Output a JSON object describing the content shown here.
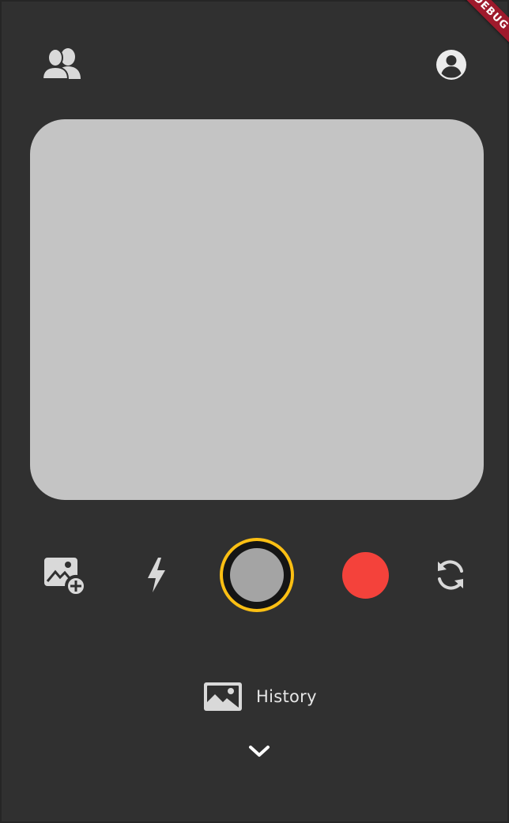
{
  "app": {
    "debug_banner": "DEBUG"
  },
  "header": {
    "friends_icon": "people-icon",
    "profile_icon": "account-circle-icon"
  },
  "controls": {
    "gallery_icon": "add-photo-icon",
    "flash_icon": "flash-icon",
    "shutter_colors": {
      "outer": "#fbbf13",
      "ring": "#151515",
      "core": "#a4a4a4"
    },
    "record_color": "#f4423b",
    "flip_icon": "flip-camera-icon"
  },
  "history": {
    "icon": "image-icon",
    "label": "History"
  },
  "footer": {
    "expand_icon": "chevron-down-icon"
  }
}
